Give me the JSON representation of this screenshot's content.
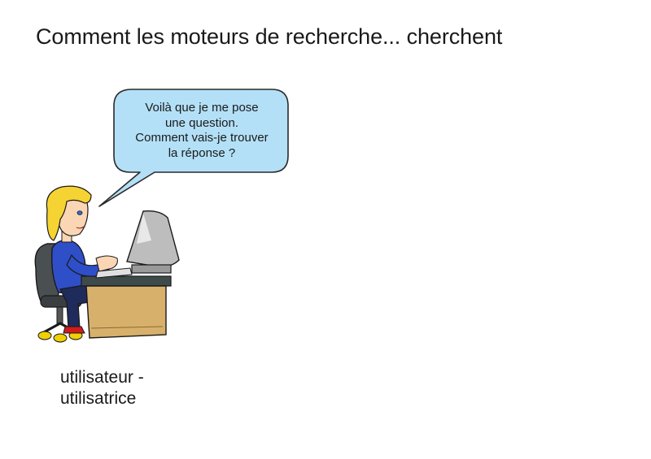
{
  "slide": {
    "title": "Comment les moteurs de recherche... cherchent"
  },
  "speech_bubble": {
    "lines": [
      "Voilà que je me pose",
      "une question.",
      "Comment vais-je trouver",
      "la réponse ?"
    ],
    "fill_color": "#b3e0f7"
  },
  "user_caption": {
    "lines": [
      "utilisateur -",
      "utilisatrice"
    ]
  },
  "illustration": {
    "desk_color": "#d7b06b",
    "shirt_color": "#2f4fc8",
    "hair_color": "#f5d332",
    "monitor_color": "#bdbdbd"
  }
}
